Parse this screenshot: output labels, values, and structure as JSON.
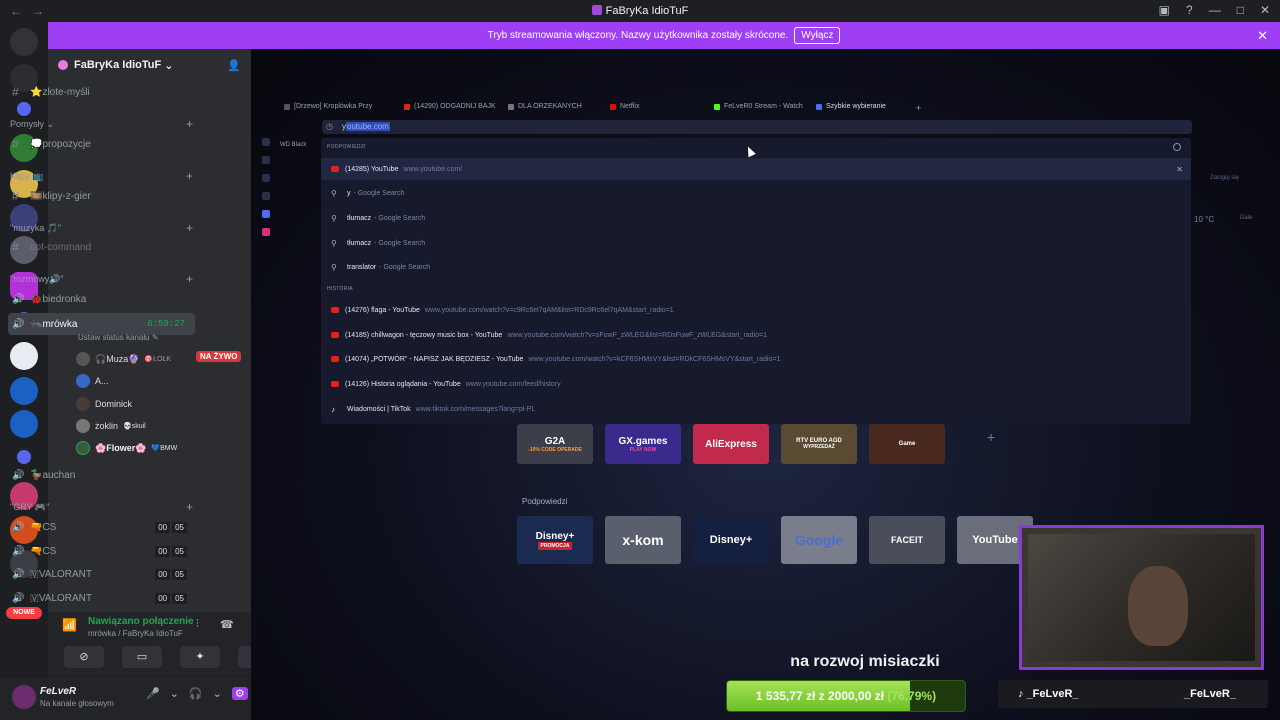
{
  "window": {
    "title": "FaBryKa IdioTuF"
  },
  "banner": {
    "text": "Tryb streamowania włączony. Nazwy użytkownika zostały skrócone.",
    "button": "Wyłącz"
  },
  "rail": {
    "nowe": "NOWE"
  },
  "guild": {
    "name": "FaBryKa IdioTuF"
  },
  "channels": {
    "zlote_mysli": "⭐złote-myśli",
    "cat_pomysly": "Pomysły ⌄",
    "propozycje": "💭propozycje",
    "cat_klipy": "Klipy 📺",
    "klipy_z_gier": "🎞️klipy-z-gier",
    "cat_muzyka": "\"muzyka 🎵\"",
    "bot_command": "bot-command",
    "cat_rozmowy": "\"rozmowy🔊\"",
    "biedronka": "🐞biedronka",
    "mrowka": "🐜mrówka",
    "mrowka_time": "6:59:27",
    "mrowka_status": "Ustaw status kanału",
    "users": [
      "🎧Muza🔮",
      "A...",
      "Dominick",
      "żoklin",
      "🌸Flower🌸"
    ],
    "user_tags": [
      "🎯ŁOŁK",
      "",
      "",
      "💀skuil",
      "💙BMW"
    ],
    "live": "NA ŻYWO",
    "auchan": "🦆auchan",
    "cat_gry": "\"GRY 🎮\"",
    "cs1": "🔫CS",
    "cs2": "🔫CS",
    "valorant1": "🇻VALORANT",
    "valorant2": "🇻VALORANT",
    "count_a": "00",
    "count_b": "05"
  },
  "voice": {
    "status": "Nawiązano połączenie",
    "location": "mrówka / FaBryKa IdioTuF"
  },
  "user": {
    "name": "FeLveR",
    "status": "Na kanale głosowym"
  },
  "browser": {
    "tabs": [
      "[Drzewo] Kroplówka Przy",
      "(14290) ODGADNIJ BAJK",
      "DLA ORZEKANYCH",
      "Netflix",
      "FeLveR0 Stream - Watch",
      "Szybkie wybieranie"
    ],
    "address_typed": "y",
    "address_suggest": "outube.com",
    "bookmark": "WD Black",
    "section_suggestions": "PODPOWIEDZI",
    "section_history": "HISTORIA",
    "suggestions": [
      {
        "title": "(14285) YouTube",
        "url": "www.youtube.com/"
      },
      {
        "title": "y",
        "url": "- Google Search"
      },
      {
        "title": "tłumacz",
        "url": "- Google Search"
      },
      {
        "title": "tłumacz",
        "url": "- Google Search"
      },
      {
        "title": "translator",
        "url": "- Google Search"
      }
    ],
    "history": [
      {
        "title": "(14276) flaga - YouTube",
        "url": "www.youtube.com/watch?v=c9Rc6el7qAM&list=RDc9Rc6el7qAM&start_radio=1"
      },
      {
        "title": "(14185) chillwagon - tęczowy music box - YouTube",
        "url": "www.youtube.com/watch?v=sFuwF_zWLEG&list=RDsFuwF_zWLEG&start_radio=1"
      },
      {
        "title": "(14074) „POTWÓR\" - NAPISZ JAK BĘDZIESZ - YouTube",
        "url": "www.youtube.com/watch?v=kCF6SHMsVY&list=RDkCF6SHMsVY&start_radio=1"
      },
      {
        "title": "(14126) Historia oglądania - YouTube",
        "url": "www.youtube.com/feed/history"
      },
      {
        "title": "Wiadomości | TikTok",
        "url": "www.tiktok.com/messages?lang=pl-PL"
      }
    ],
    "speed_dial_top": [
      "G2A",
      "GX.games",
      "AliExpress",
      "RTV EURO AGD",
      "Game"
    ],
    "speed_dial_top_sub": [
      "-10% CODE OPERADE",
      "PLAY NOW",
      "",
      "WYPRZEDAŻ",
      ""
    ],
    "podpowiedzi": "Podpowiedzi",
    "speed_dial_bottom": [
      "Disney+",
      "x-kom",
      "Disney+",
      "Google",
      "FACEIT",
      "YouTube"
    ],
    "promo": "PROMOCJA",
    "weather": "10 °C",
    "weather_side": "Dale",
    "side_right": "Zaloguj się"
  },
  "overlay": {
    "subtitle": "na rozwoj misiaczki",
    "goal_current": "1 535,77 zł",
    "goal_sep": "z",
    "goal_target": "2000,00 zł",
    "goal_pct": "(76.79%)",
    "goal_fraction": 0.7679,
    "tiktok1": "_FeLveR_",
    "tiktok2": "_FeLveR_"
  }
}
